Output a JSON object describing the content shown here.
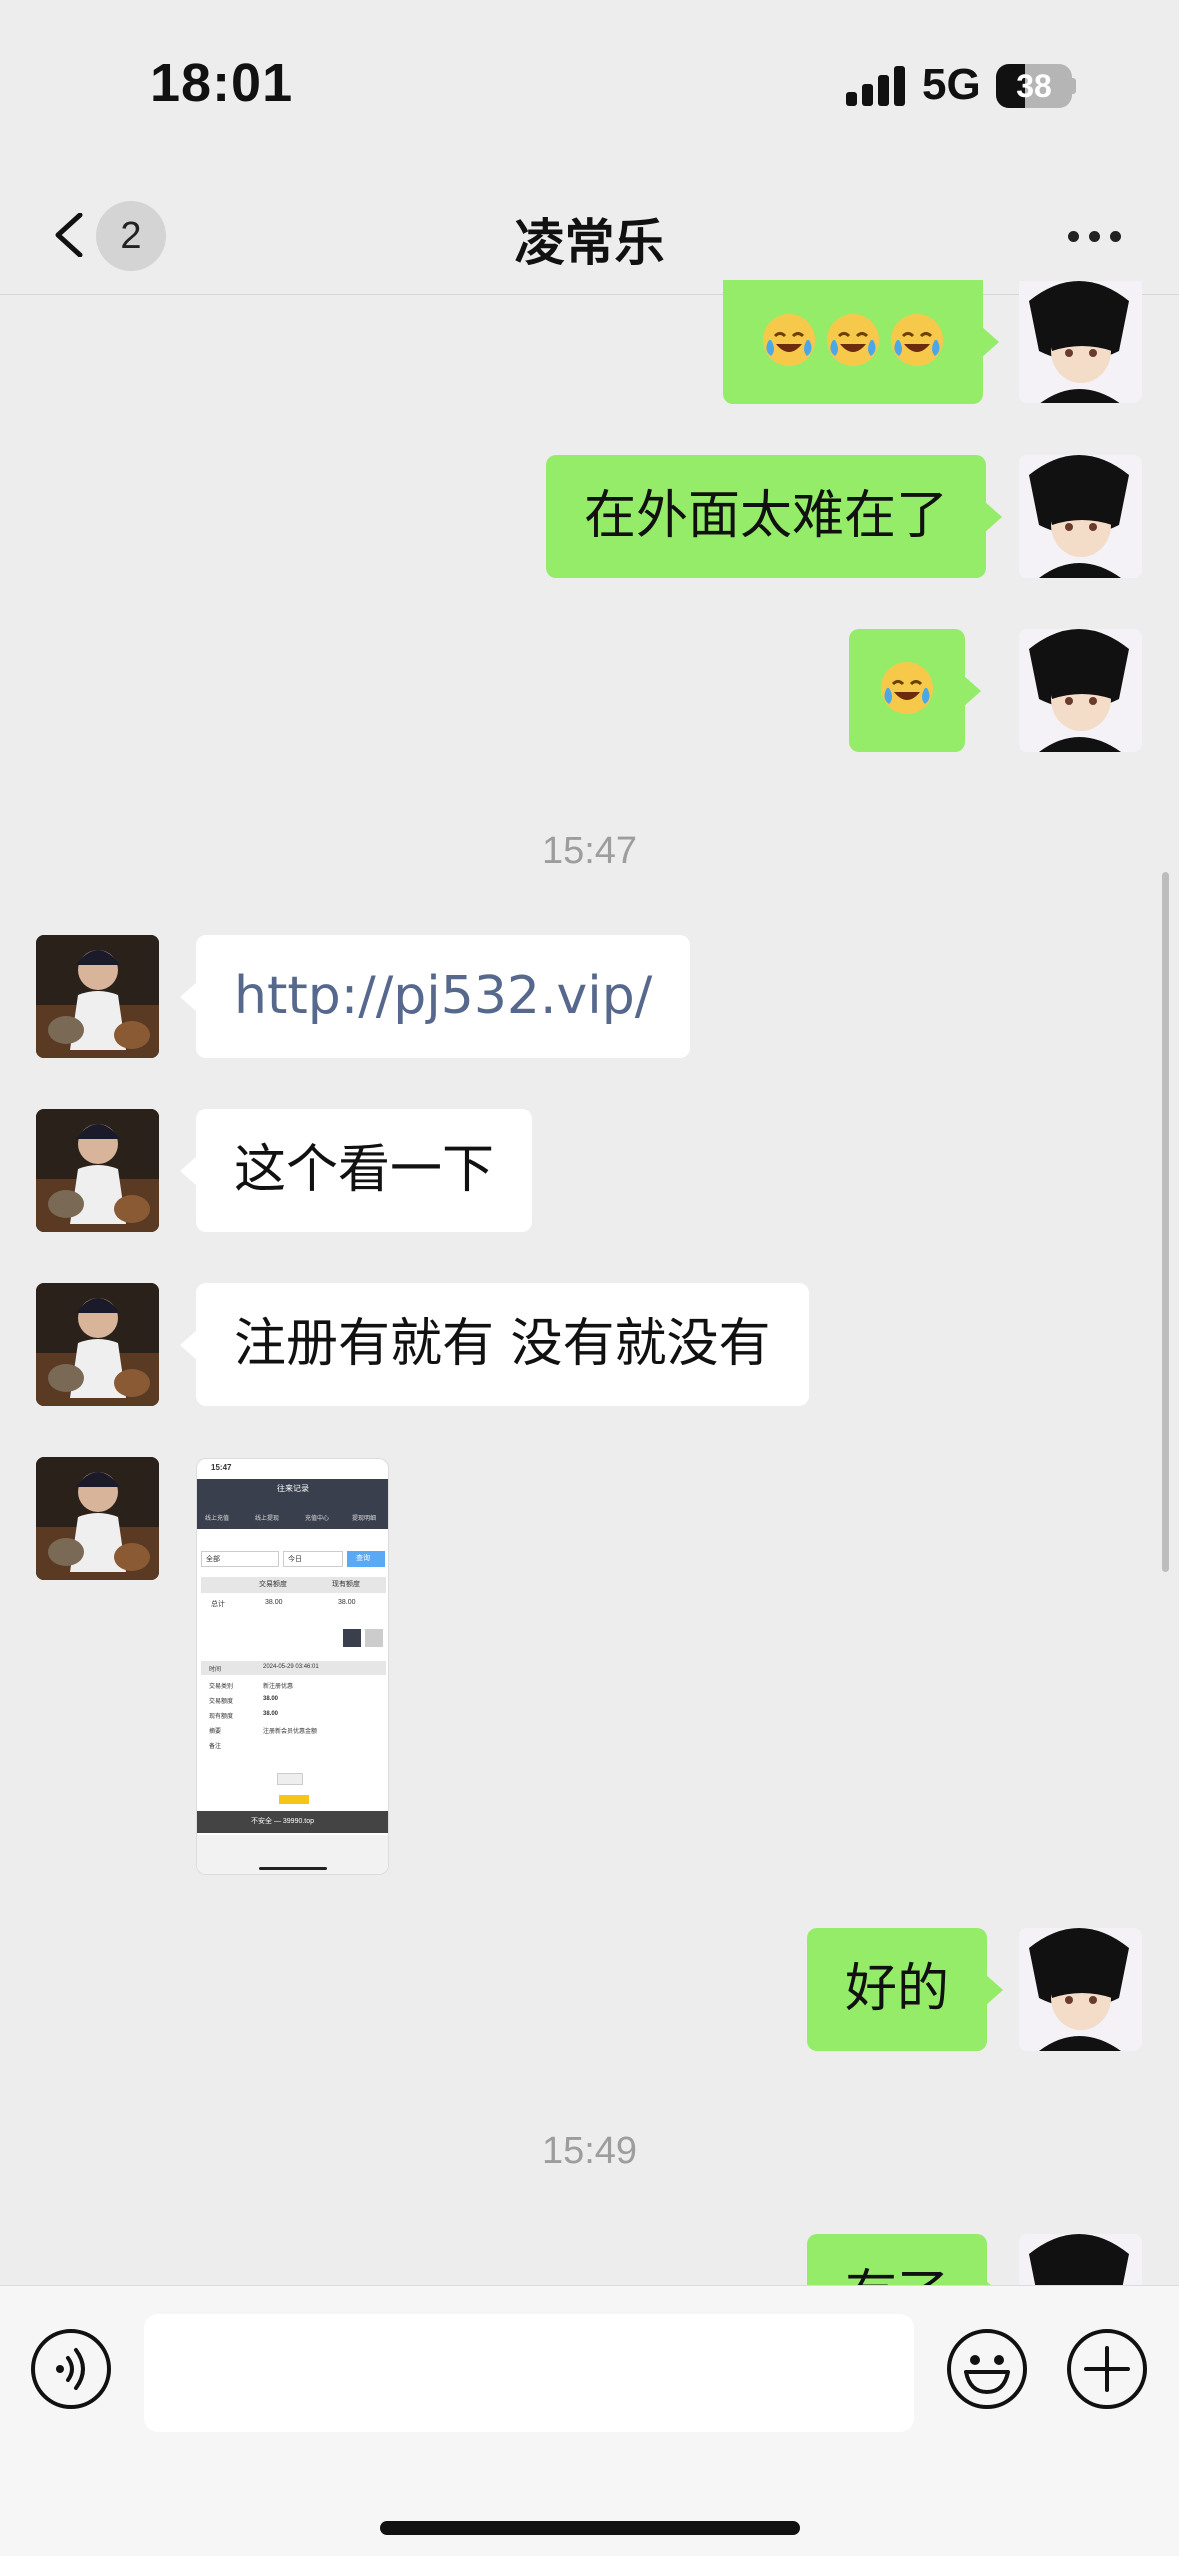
{
  "status_bar": {
    "time": "18:01",
    "network": "5G",
    "battery_level": "38"
  },
  "nav": {
    "unread_count": "2",
    "title": "凌常乐"
  },
  "colors": {
    "outgoing_bubble": "#95ec69",
    "incoming_bubble": "#ffffff",
    "link": "#56698d",
    "background": "#ededed"
  },
  "messages": [
    {
      "direction": "out",
      "type": "emoji",
      "emoji": "😂😂😂"
    },
    {
      "direction": "out",
      "type": "text",
      "text": "在外面太难在了"
    },
    {
      "direction": "out",
      "type": "emoji",
      "emoji": "😂"
    },
    {
      "type": "timestamp",
      "text": "15:47"
    },
    {
      "direction": "in",
      "type": "link",
      "text": "http://pj532.vip/"
    },
    {
      "direction": "in",
      "type": "text",
      "text": "这个看一下"
    },
    {
      "direction": "in",
      "type": "text",
      "text": "注册有就有 没有就没有"
    },
    {
      "direction": "in",
      "type": "image",
      "image": {
        "time": "15:47",
        "title": "往来记录",
        "tabs": [
          "线上充值",
          "线上提现",
          "充值中心",
          "提现明细"
        ],
        "filter_all": "全部",
        "filter_today": "今日",
        "search_btn": "查询",
        "headers": [
          "交易额度",
          "现有额度"
        ],
        "row_label": "总计",
        "row_values": [
          "38.00",
          "38.00"
        ],
        "details": [
          [
            "时间",
            "2024-05-29 03:46:01"
          ],
          [
            "交易类别",
            "新注册优惠"
          ],
          [
            "交易额度",
            "38.00"
          ],
          [
            "现有额度",
            "38.00"
          ],
          [
            "摘要",
            "注册新会员优惠金额"
          ],
          [
            "备注",
            ""
          ]
        ],
        "url": "不安全 — 39990.top"
      }
    },
    {
      "direction": "out",
      "type": "text",
      "text": "好的"
    },
    {
      "type": "timestamp",
      "text": "15:49"
    },
    {
      "direction": "out",
      "type": "text",
      "text": "有了"
    }
  ],
  "input": {
    "placeholder": ""
  }
}
